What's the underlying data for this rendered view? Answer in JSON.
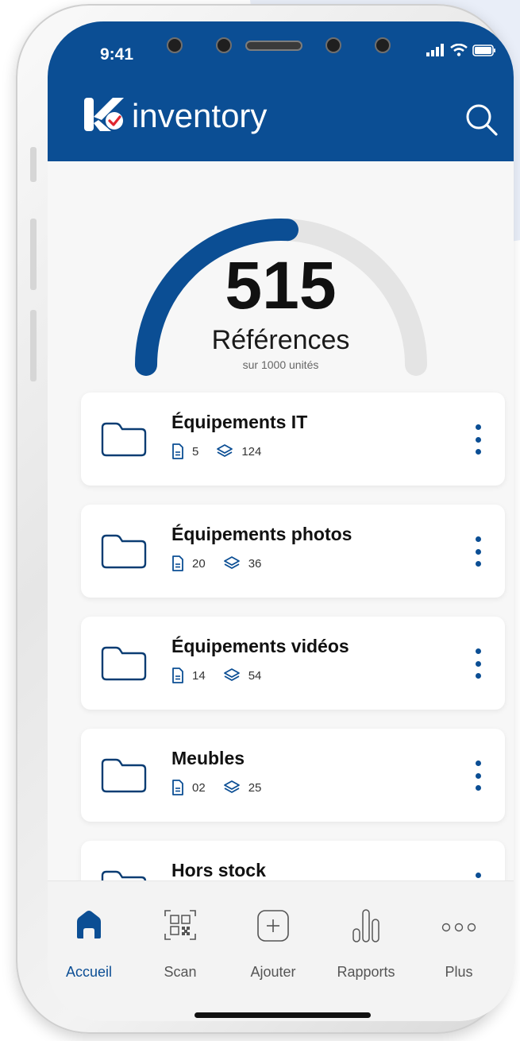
{
  "status_bar": {
    "time": "9:41"
  },
  "header": {
    "brand": "inventory",
    "search_icon": "search-icon"
  },
  "colors": {
    "primary": "#0b4e94",
    "accent_red": "#e0262f",
    "gauge_track": "#e4e4e4"
  },
  "gauge": {
    "value": "515",
    "label": "Références",
    "sublabel": "sur 1000 unités",
    "fill_fraction": 0.515
  },
  "categories": [
    {
      "title": "Équipements IT",
      "docs": "5",
      "units": "124"
    },
    {
      "title": "Équipements photos",
      "docs": "20",
      "units": "36"
    },
    {
      "title": "Équipements vidéos",
      "docs": "14",
      "units": "54"
    },
    {
      "title": "Meubles",
      "docs": "02",
      "units": "25"
    },
    {
      "title": "Hors stock",
      "docs": "",
      "units": ""
    }
  ],
  "tabs": [
    {
      "label": "Accueil",
      "icon": "home-icon",
      "active": true
    },
    {
      "label": "Scan",
      "icon": "qr-code-icon",
      "active": false
    },
    {
      "label": "Ajouter",
      "icon": "add-icon",
      "active": false
    },
    {
      "label": "Rapports",
      "icon": "bar-chart-icon",
      "active": false
    },
    {
      "label": "Plus",
      "icon": "more-horizontal-icon",
      "active": false
    }
  ]
}
